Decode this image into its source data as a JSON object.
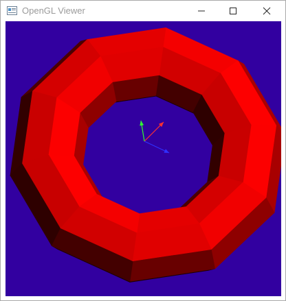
{
  "window": {
    "title": "OpenGL Viewer",
    "controls": [
      "minimize",
      "maximize",
      "close"
    ]
  },
  "viewport": {
    "background_color": "#3200a0",
    "model": "torus",
    "model_color": "#ff0000",
    "axes": [
      {
        "name": "x",
        "color": "#ff3030"
      },
      {
        "name": "y",
        "color": "#30ff30"
      },
      {
        "name": "z",
        "color": "#3030ff"
      }
    ]
  }
}
